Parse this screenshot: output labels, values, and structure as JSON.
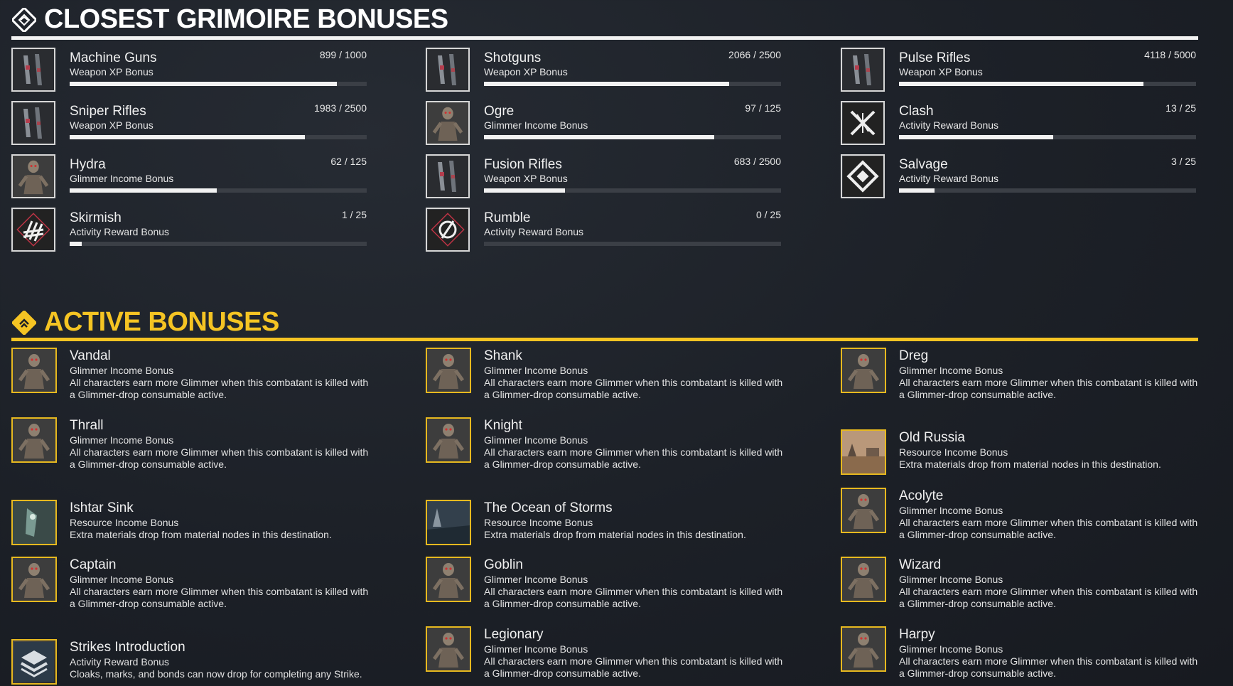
{
  "grimoire": {
    "title": "CLOSEST GRIMOIRE BONUSES",
    "items": [
      {
        "name": "Machine Guns",
        "type": "Weapon XP Bonus",
        "progress": "899 / 1000",
        "fraction": 0.899,
        "icon": "machine-gun-icon"
      },
      {
        "name": "Shotguns",
        "type": "Weapon XP Bonus",
        "progress": "2066 / 2500",
        "fraction": 0.826,
        "icon": "shotgun-icon"
      },
      {
        "name": "Pulse Rifles",
        "type": "Weapon XP Bonus",
        "progress": "4118 / 5000",
        "fraction": 0.824,
        "icon": "pulse-rifle-icon"
      },
      {
        "name": "Sniper Rifles",
        "type": "Weapon XP Bonus",
        "progress": "1983 / 2500",
        "fraction": 0.793,
        "icon": "sniper-rifle-icon"
      },
      {
        "name": "Ogre",
        "type": "Glimmer Income Bonus",
        "progress": "97 / 125",
        "fraction": 0.776,
        "icon": "ogre-icon"
      },
      {
        "name": "Clash",
        "type": "Activity Reward Bonus",
        "progress": "13 / 25",
        "fraction": 0.52,
        "icon": "clash-icon"
      },
      {
        "name": "Hydra",
        "type": "Glimmer Income Bonus",
        "progress": "62 / 125",
        "fraction": 0.496,
        "icon": "hydra-icon"
      },
      {
        "name": "Fusion Rifles",
        "type": "Weapon XP Bonus",
        "progress": "683 / 2500",
        "fraction": 0.273,
        "icon": "fusion-rifle-icon"
      },
      {
        "name": "Salvage",
        "type": "Activity Reward Bonus",
        "progress": "3 / 25",
        "fraction": 0.12,
        "icon": "salvage-icon"
      },
      {
        "name": "Skirmish",
        "type": "Activity Reward Bonus",
        "progress": "1 / 25",
        "fraction": 0.04,
        "icon": "skirmish-icon"
      },
      {
        "name": "Rumble",
        "type": "Activity Reward Bonus",
        "progress": "0 / 25",
        "fraction": 0.0,
        "icon": "rumble-icon"
      }
    ]
  },
  "active": {
    "title": "ACTIVE BONUSES",
    "items": [
      {
        "name": "Vandal",
        "type": "Glimmer Income Bonus",
        "desc": "All characters earn more Glimmer when this combatant is killed with a Glimmer-drop consumable active.",
        "icon": "vandal-icon"
      },
      {
        "name": "Shank",
        "type": "Glimmer Income Bonus",
        "desc": "All characters earn more Glimmer when this combatant is killed with a Glimmer-drop consumable active.",
        "icon": "shank-icon"
      },
      {
        "name": "Dreg",
        "type": "Glimmer Income Bonus",
        "desc": "All characters earn more Glimmer when this combatant is killed with a Glimmer-drop consumable active.",
        "icon": "dreg-icon"
      },
      {
        "name": "Thrall",
        "type": "Glimmer Income Bonus",
        "desc": "All characters earn more Glimmer when this combatant is killed with a Glimmer-drop consumable active.",
        "icon": "thrall-icon"
      },
      {
        "name": "Knight",
        "type": "Glimmer Income Bonus",
        "desc": "All characters earn more Glimmer when this combatant is killed with a Glimmer-drop consumable active.",
        "icon": "knight-icon"
      },
      {
        "name": "Old Russia",
        "type": "Resource Income Bonus",
        "desc": "Extra materials drop from material nodes in this destination.",
        "icon": "old-russia-icon"
      },
      {
        "name": "Ishtar Sink",
        "type": "Resource Income Bonus",
        "desc": "Extra materials drop from material nodes in this destination.",
        "icon": "ishtar-sink-icon"
      },
      {
        "name": "The Ocean of Storms",
        "type": "Resource Income Bonus",
        "desc": "Extra materials drop from material nodes in this destination.",
        "icon": "ocean-of-storms-icon"
      },
      {
        "name": "Acolyte",
        "type": "Glimmer Income Bonus",
        "desc": "All characters earn more Glimmer when this combatant is killed with a Glimmer-drop consumable active.",
        "icon": "acolyte-icon"
      },
      {
        "name": "Captain",
        "type": "Glimmer Income Bonus",
        "desc": "All characters earn more Glimmer when this combatant is killed with a Glimmer-drop consumable active.",
        "icon": "captain-icon"
      },
      {
        "name": "Goblin",
        "type": "Glimmer Income Bonus",
        "desc": "All characters earn more Glimmer when this combatant is killed with a Glimmer-drop consumable active.",
        "icon": "goblin-icon"
      },
      {
        "name": "Wizard",
        "type": "Glimmer Income Bonus",
        "desc": "All characters earn more Glimmer when this combatant is killed with a Glimmer-drop consumable active.",
        "icon": "wizard-icon"
      },
      {
        "name": "Strikes Introduction",
        "type": "Activity Reward Bonus",
        "desc": "Cloaks, marks, and bonds can now drop for completing any Strike.",
        "icon": "strikes-icon"
      },
      {
        "name": "Legionary",
        "type": "Glimmer Income Bonus",
        "desc": "All characters earn more Glimmer when this combatant is killed with a Glimmer-drop consumable active.",
        "icon": "legionary-icon"
      },
      {
        "name": "Harpy",
        "type": "Glimmer Income Bonus",
        "desc": "All characters earn more Glimmer when this combatant is killed with a Glimmer-drop consumable active.",
        "icon": "harpy-icon"
      }
    ]
  },
  "colors": {
    "accent": "#f5c423",
    "text": "#e8e8e8",
    "background": "#1c2026"
  }
}
